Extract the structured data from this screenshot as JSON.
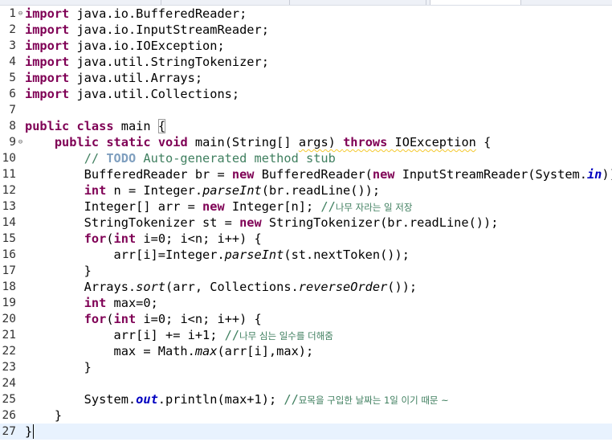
{
  "editor": {
    "lines": [
      {
        "num": "1",
        "fold": "⊖",
        "segs": [
          {
            "t": "import",
            "c": "kw"
          },
          {
            "t": " java.io.BufferedReader;"
          }
        ]
      },
      {
        "num": "2",
        "segs": [
          {
            "t": "import",
            "c": "kw"
          },
          {
            "t": " java.io.InputStreamReader;"
          }
        ]
      },
      {
        "num": "3",
        "segs": [
          {
            "t": "import",
            "c": "kw"
          },
          {
            "t": " java.io.IOException;"
          }
        ]
      },
      {
        "num": "4",
        "segs": [
          {
            "t": "import",
            "c": "kw"
          },
          {
            "t": " java.util.StringTokenizer;"
          }
        ]
      },
      {
        "num": "5",
        "segs": [
          {
            "t": "import",
            "c": "kw"
          },
          {
            "t": " java.util.Arrays;"
          }
        ]
      },
      {
        "num": "6",
        "segs": [
          {
            "t": "import",
            "c": "kw"
          },
          {
            "t": " java.util.Collections;"
          }
        ]
      },
      {
        "num": "7",
        "segs": []
      },
      {
        "num": "8",
        "segs": [
          {
            "t": "public",
            "c": "kw"
          },
          {
            "t": " "
          },
          {
            "t": "class",
            "c": "kw"
          },
          {
            "t": " main "
          },
          {
            "t": "{",
            "c": "bracket"
          }
        ]
      },
      {
        "num": "9",
        "fold": "⊖",
        "segs": [
          {
            "t": "    "
          },
          {
            "t": "public",
            "c": "kw"
          },
          {
            "t": " "
          },
          {
            "t": "static",
            "c": "kw"
          },
          {
            "t": " "
          },
          {
            "t": "void",
            "c": "kw"
          },
          {
            "t": " main(String[] "
          },
          {
            "t": "args) ",
            "c": "warn"
          },
          {
            "t": "throws",
            "c": "kw warn"
          },
          {
            "t": " IOException",
            "c": "warn"
          },
          {
            "t": " {"
          }
        ]
      },
      {
        "num": "10",
        "segs": [
          {
            "t": "        "
          },
          {
            "t": "// ",
            "c": "cm"
          },
          {
            "t": "TODO",
            "c": "todo"
          },
          {
            "t": " Auto-generated method stub",
            "c": "cm"
          }
        ]
      },
      {
        "num": "11",
        "segs": [
          {
            "t": "        BufferedReader br = "
          },
          {
            "t": "new",
            "c": "kw"
          },
          {
            "t": " BufferedReader("
          },
          {
            "t": "new",
            "c": "kw"
          },
          {
            "t": " InputStreamReader(System."
          },
          {
            "t": "in",
            "c": "field"
          },
          {
            "t": "));"
          }
        ]
      },
      {
        "num": "12",
        "segs": [
          {
            "t": "        "
          },
          {
            "t": "int",
            "c": "kw"
          },
          {
            "t": " n = Integer."
          },
          {
            "t": "parseInt",
            "c": "st"
          },
          {
            "t": "(br.readLine());"
          }
        ]
      },
      {
        "num": "13",
        "segs": [
          {
            "t": "        Integer[] arr = "
          },
          {
            "t": "new",
            "c": "kw"
          },
          {
            "t": " Integer[n]; "
          },
          {
            "t": "//",
            "c": "cm"
          },
          {
            "t": "나무 자라는 일 저장",
            "c": "cm kr"
          }
        ]
      },
      {
        "num": "14",
        "segs": [
          {
            "t": "        StringTokenizer st = "
          },
          {
            "t": "new",
            "c": "kw"
          },
          {
            "t": " StringTokenizer(br.readLine());"
          }
        ]
      },
      {
        "num": "15",
        "segs": [
          {
            "t": "        "
          },
          {
            "t": "for",
            "c": "kw"
          },
          {
            "t": "("
          },
          {
            "t": "int",
            "c": "kw"
          },
          {
            "t": " i=0; i<n; i++) {"
          }
        ]
      },
      {
        "num": "16",
        "segs": [
          {
            "t": "            arr[i]=Integer."
          },
          {
            "t": "parseInt",
            "c": "st"
          },
          {
            "t": "(st.nextToken());"
          }
        ]
      },
      {
        "num": "17",
        "segs": [
          {
            "t": "        }"
          }
        ]
      },
      {
        "num": "18",
        "segs": [
          {
            "t": "        Arrays."
          },
          {
            "t": "sort",
            "c": "st"
          },
          {
            "t": "(arr, Collections."
          },
          {
            "t": "reverseOrder",
            "c": "st"
          },
          {
            "t": "());"
          }
        ]
      },
      {
        "num": "19",
        "segs": [
          {
            "t": "        "
          },
          {
            "t": "int",
            "c": "kw"
          },
          {
            "t": " max=0;"
          }
        ]
      },
      {
        "num": "20",
        "segs": [
          {
            "t": "        "
          },
          {
            "t": "for",
            "c": "kw"
          },
          {
            "t": "("
          },
          {
            "t": "int",
            "c": "kw"
          },
          {
            "t": " i=0; i<n; i++) {"
          }
        ]
      },
      {
        "num": "21",
        "segs": [
          {
            "t": "            arr[i] += i+1; "
          },
          {
            "t": "//",
            "c": "cm"
          },
          {
            "t": "나무 심는 일수를 더해줌",
            "c": "cm kr"
          }
        ]
      },
      {
        "num": "22",
        "segs": [
          {
            "t": "            max = Math."
          },
          {
            "t": "max",
            "c": "st"
          },
          {
            "t": "(arr[i],max);"
          }
        ]
      },
      {
        "num": "23",
        "segs": [
          {
            "t": "        }"
          }
        ]
      },
      {
        "num": "24",
        "segs": []
      },
      {
        "num": "25",
        "segs": [
          {
            "t": "        System."
          },
          {
            "t": "out",
            "c": "field"
          },
          {
            "t": ".println(max+1); "
          },
          {
            "t": "//",
            "c": "cm"
          },
          {
            "t": "묘목을 구입한 날짜는 1일 이기 때문 ~",
            "c": "cm kr"
          }
        ]
      },
      {
        "num": "26",
        "segs": [
          {
            "t": "    }"
          }
        ]
      },
      {
        "num": "27",
        "current": true,
        "segs": [
          {
            "t": "}"
          },
          {
            "t": "",
            "c": "caret"
          }
        ]
      }
    ]
  }
}
